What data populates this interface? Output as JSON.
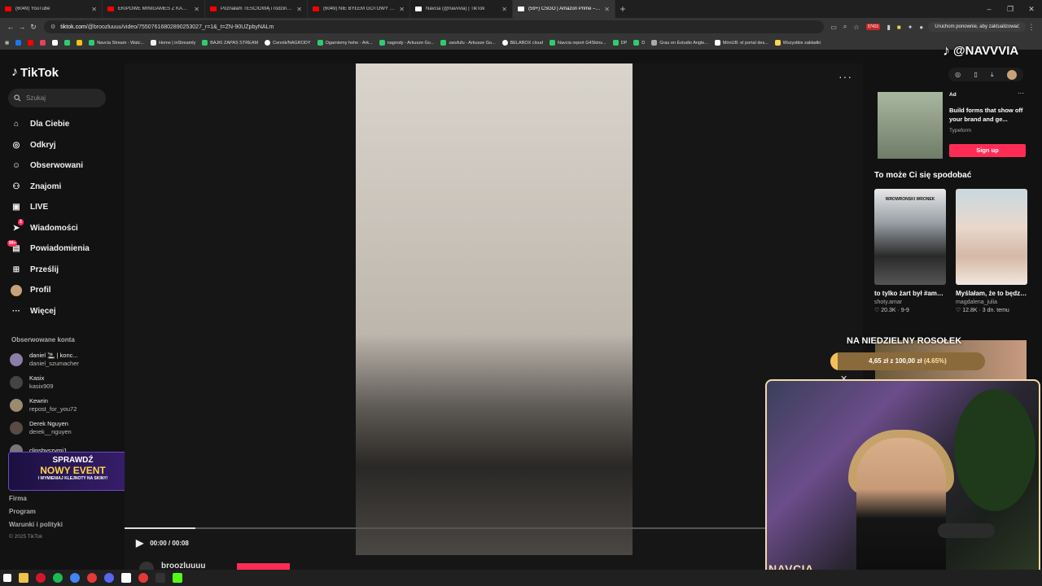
{
  "browser": {
    "tabs": [
      {
        "label": "(6049) YouTube",
        "color": "#ff0000"
      },
      {
        "label": "EKIPOWE MINIGAMES Z KARAMI",
        "color": "#ff0000"
      },
      {
        "label": "Poznałam TEŚCIOWĄ i rodzinę Sy",
        "color": "#ff0000"
      },
      {
        "label": "(6049) NIE BYŁEM GOTOWY NA TO",
        "color": "#ff0000"
      },
      {
        "label": "Navcia (@navvvia) | TikTok",
        "color": "#ffffff"
      },
      {
        "label": "(59+) CSGO | Amazon Prime – zal",
        "color": "#ffffff"
      }
    ],
    "active_tab": 5,
    "url_host": "tiktok.com",
    "url_path": "/@broozluuuu/video/75507616802890253027_r=1&_t=ZN-90UZpbyNALm",
    "extension_badge": "37431",
    "restart_label": "Uruchom ponownie, aby zaktualizować",
    "bookmarks": [
      {
        "label": "",
        "color": "#1877f2"
      },
      {
        "label": "",
        "color": "#ff0000"
      },
      {
        "label": "",
        "color": "#e4405f"
      },
      {
        "label": "",
        "color": "#ffffff"
      },
      {
        "label": "",
        "color": "#2ecc71"
      },
      {
        "label": "",
        "color": "#f1c40f"
      },
      {
        "label": "Navcia Stream - Watc...",
        "color": "#2ecc71"
      },
      {
        "label": "Home | inStreamly",
        "color": "#f0f0f0"
      },
      {
        "label": "BAJKI ZAPAS STREAM",
        "color": "#2ecc71"
      },
      {
        "label": "Cennik/NAGRODY",
        "color": "#ffffff"
      },
      {
        "label": "Ogarniemy hehe - Ark...",
        "color": "#2ecc71"
      },
      {
        "label": "nagrody - Arkusze Go...",
        "color": "#2ecc71"
      },
      {
        "label": "uwufufu - Arkusze Go...",
        "color": "#2ecc71"
      },
      {
        "label": "BELABOX cloud",
        "color": "#ffffff"
      },
      {
        "label": "Navcia report G4Skins...",
        "color": "#2ecc71"
      },
      {
        "label": "DP",
        "color": "#2ecc71"
      },
      {
        "label": "D",
        "color": "#2ecc71"
      },
      {
        "label": "Grau en Estudio Angle...",
        "color": "#aaaaaa"
      },
      {
        "label": "MónUB: el portal des...",
        "color": "#ffffff"
      },
      {
        "label": "Wszystkie zakładki",
        "color": "#ffd54a"
      }
    ]
  },
  "tiktok": {
    "logo": "TikTok",
    "search_placeholder": "Szukaj",
    "menu": [
      {
        "label": "Dla Ciebie",
        "icon": "home-icon"
      },
      {
        "label": "Odkryj",
        "icon": "compass-icon"
      },
      {
        "label": "Obserwowani",
        "icon": "following-icon"
      },
      {
        "label": "Znajomi",
        "icon": "friends-icon"
      },
      {
        "label": "LIVE",
        "icon": "live-icon"
      },
      {
        "label": "Wiadomości",
        "icon": "messages-icon",
        "badge": "3"
      },
      {
        "label": "Powiadomienia",
        "icon": "notifications-icon",
        "badge": "99+"
      },
      {
        "label": "Prześlij",
        "icon": "upload-icon"
      },
      {
        "label": "Profil",
        "icon": "profile-icon"
      },
      {
        "label": "Więcej",
        "icon": "more-icon"
      }
    ],
    "followed_header": "Obserwowane konta",
    "followed": [
      {
        "name": "daniel 🚬 | konc...",
        "handle": "daniel_szumacher"
      },
      {
        "name": "Kasix",
        "handle": "kasix909"
      },
      {
        "name": "Kewrin",
        "handle": "repost_for_you72"
      },
      {
        "name": "Derek Nguyen",
        "handle": "derek__nguyen"
      },
      {
        "name": "clipsbyszymi1",
        "handle": ""
      }
    ],
    "footer": [
      "Firma",
      "Program",
      "Warunki i polityki"
    ],
    "copyright": "© 2025 TikTok",
    "video": {
      "time": "00:00 / 00:08",
      "progress": 0.11,
      "author": "broozluuuu"
    },
    "ad": {
      "tag": "Ad",
      "text": "Build forms that show off your brand and ge...",
      "brand": "Typeform",
      "button": "Sign up"
    },
    "recommend_header": "To może Ci się spodobać",
    "recommendations": [
      {
        "caption": "to tylko żart był #amar #wronek...",
        "user": "shoty.amar",
        "stats": "♡ 20.3K · 9-9",
        "overlay": "WROWRONSKI WRONEK"
      },
      {
        "caption": "Myślałam, że to będzie rutynowe kt...",
        "user": "magdalena_julia",
        "stats": "♡ 12.8K · 3 dn. temu",
        "overlay": ""
      }
    ]
  },
  "stream_overlay": {
    "handle": "@NAVVVIA",
    "goal_title": "NA NIEDZIELNY ROSOŁEK",
    "goal_current": "4,65 zł",
    "goal_sep": "z",
    "goal_target": "100,00 zł",
    "goal_pct": "(4.65%)",
    "goal_fraction": 0.0465,
    "event_line1": "SPRAWDŹ",
    "event_line2": "NOWY EVENT",
    "event_line3": "I WYMIENIAJ KLEJNOTY NA SKINY!",
    "cam_name": "NAVCIA"
  }
}
